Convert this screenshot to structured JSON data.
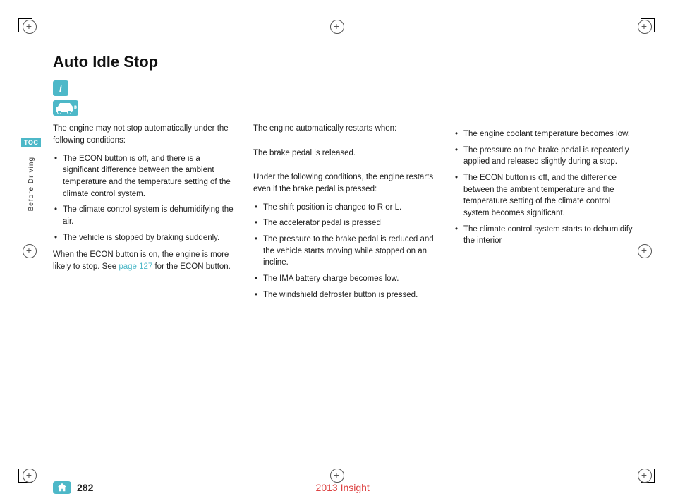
{
  "page": {
    "title": "Auto Idle Stop",
    "page_number": "282",
    "footer_center": "2013 Insight",
    "toc_label": "TOC",
    "sidebar_label": "Before Driving"
  },
  "icons": {
    "info_icon": "i",
    "home_label": "Home"
  },
  "column1": {
    "intro": "The engine may not stop automatically under the following conditions:",
    "bullets": [
      "The ECON button is off, and there is a significant difference between the ambient temperature and the temperature setting of the climate control system.",
      "The climate control system is dehumidifying the air.",
      "The vehicle is stopped by braking suddenly."
    ],
    "outro_prefix": "When the ECON button is on, the engine is more likely to stop. See ",
    "link_text": "page 127",
    "outro_suffix": " for the ECON button."
  },
  "column2": {
    "intro": "The engine automatically restarts when:",
    "sub_intro": "The brake pedal is released.",
    "sub_intro2": "Under the following conditions, the engine restarts even if the brake pedal is pressed:",
    "bullets": [
      "The shift position is changed to R or L.",
      "The accelerator pedal is pressed",
      "The pressure to the brake pedal is reduced and the vehicle starts moving while stopped on an incline.",
      "The IMA battery charge becomes low.",
      "The windshield defroster button is pressed."
    ]
  },
  "column3": {
    "bullets": [
      "The engine coolant temperature becomes low.",
      "The pressure on the brake pedal is repeatedly applied and released slightly during a stop.",
      "The ECON button is off, and the difference between the ambient temperature and the temperature setting of the climate control system becomes significant.",
      "The climate control system starts to dehumidify the interior"
    ]
  }
}
